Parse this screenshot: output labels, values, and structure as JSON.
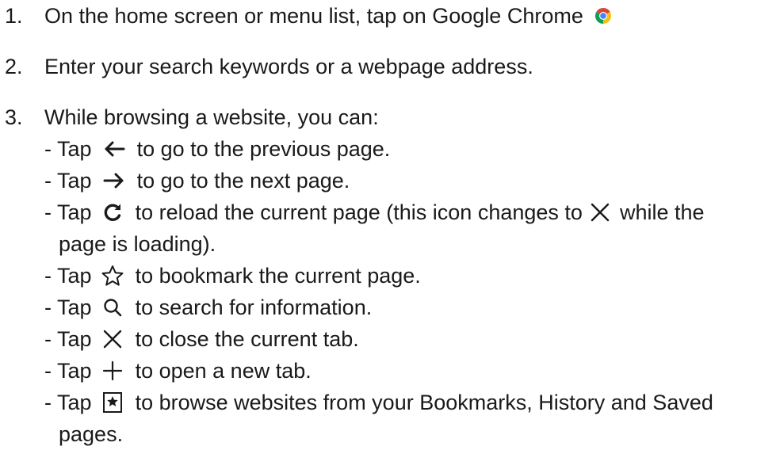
{
  "steps": [
    {
      "number": "1.",
      "text": "On the home screen or menu list, tap on Google Chrome",
      "icon": "chrome-logo-icon"
    },
    {
      "number": "2.",
      "text": "Enter your search keywords or a webpage address."
    },
    {
      "number": "3.",
      "text": "While browsing a website, you can:"
    }
  ],
  "actions": [
    {
      "prefix": "- Tap",
      "icon": "back-arrow-icon",
      "text": "to go to the previous page."
    },
    {
      "prefix": "- Tap",
      "icon": "forward-arrow-icon",
      "text": "to go to the next page."
    },
    {
      "prefix": "- Tap",
      "icon": "reload-icon",
      "text": "to reload the current page (this icon changes to",
      "icon2": "stop-x-icon",
      "text2": "while the",
      "continuation": "page is loading)."
    },
    {
      "prefix": "- Tap",
      "icon": "star-icon",
      "text": "to bookmark the current page."
    },
    {
      "prefix": "- Tap",
      "icon": "search-icon",
      "text": "to search for information."
    },
    {
      "prefix": "- Tap",
      "icon": "close-icon",
      "text": "to close the current tab."
    },
    {
      "prefix": "- Tap",
      "icon": "plus-icon",
      "text": "to open a new tab."
    },
    {
      "prefix": "- Tap",
      "icon": "bookmarks-icon",
      "text": "to browse websites from your Bookmarks, History and Saved",
      "continuation": "pages."
    }
  ],
  "colors": {
    "text": "#1a1a1a",
    "chrome_red": "#db4437",
    "chrome_yellow": "#f4c20d",
    "chrome_green": "#0f9d58",
    "chrome_blue": "#4285f4"
  }
}
